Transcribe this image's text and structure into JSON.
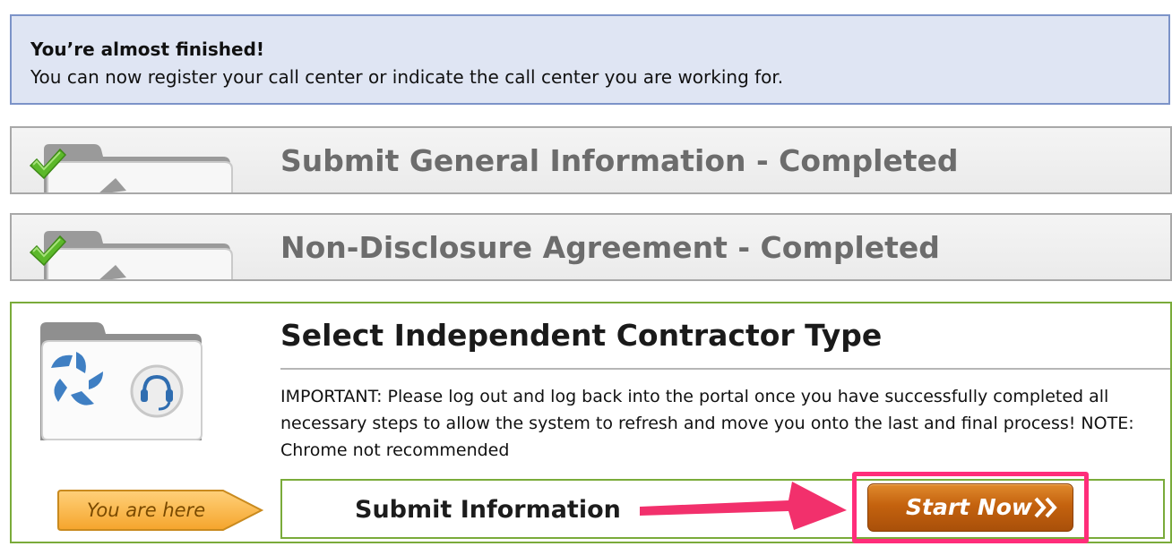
{
  "notice": {
    "title": "You’re almost finished!",
    "text": "You can now register your call center or indicate the call center you are working for."
  },
  "steps": [
    {
      "title": "Submit General Information - Completed",
      "status": "completed"
    },
    {
      "title": "Non-Disclosure Agreement - Completed",
      "status": "completed"
    }
  ],
  "active_step": {
    "title": "Select Independent Contractor Type",
    "important": "IMPORTANT: Please log out and log back into the portal once you have successfully completed all necessary steps to allow the system to refresh and move you onto the last and final process! NOTE: Chrome not recommended",
    "you_are_here": "You are here",
    "submit_label": "Submit Information",
    "start_button": "Start Now",
    "start_button_icon": "double-chevron-right-icon"
  },
  "colors": {
    "notice_bg": "#dfe5f3",
    "notice_border": "#7c93c8",
    "active_border": "#7aab3a",
    "button_orange": "#c4620e",
    "highlight_pink": "#ff2d7a",
    "check_green": "#5cb82a"
  }
}
